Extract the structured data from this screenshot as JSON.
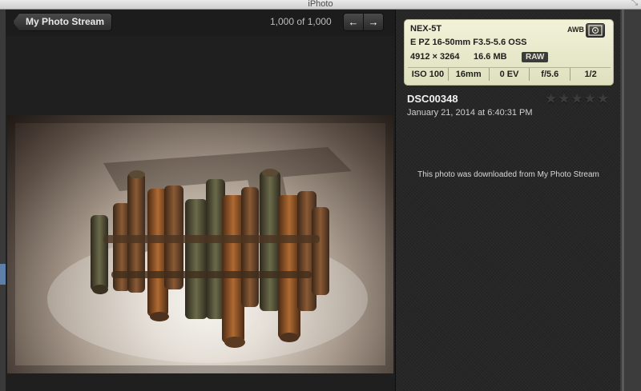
{
  "window": {
    "title": "iPhoto"
  },
  "toolbar": {
    "back_label": "My Photo Stream",
    "counter": "1,000 of 1,000",
    "prev_label": "←",
    "next_label": "→"
  },
  "info": {
    "camera": "NEX-5T",
    "lens": "E PZ 16-50mm F3.5-5.6 OSS",
    "dimensions": "4912 × 3264",
    "file_size": "16.6 MB",
    "format": "RAW",
    "white_balance": "AWB",
    "params": [
      "ISO 100",
      "16mm",
      "0 EV",
      "f/5.6",
      "1/2"
    ],
    "filename": "DSC00348",
    "date": "January 21, 2014 at 6:40:31 PM",
    "rating_stars": "★★★★★",
    "rating_value": 0,
    "note": "This photo was downloaded from My Photo Stream"
  }
}
